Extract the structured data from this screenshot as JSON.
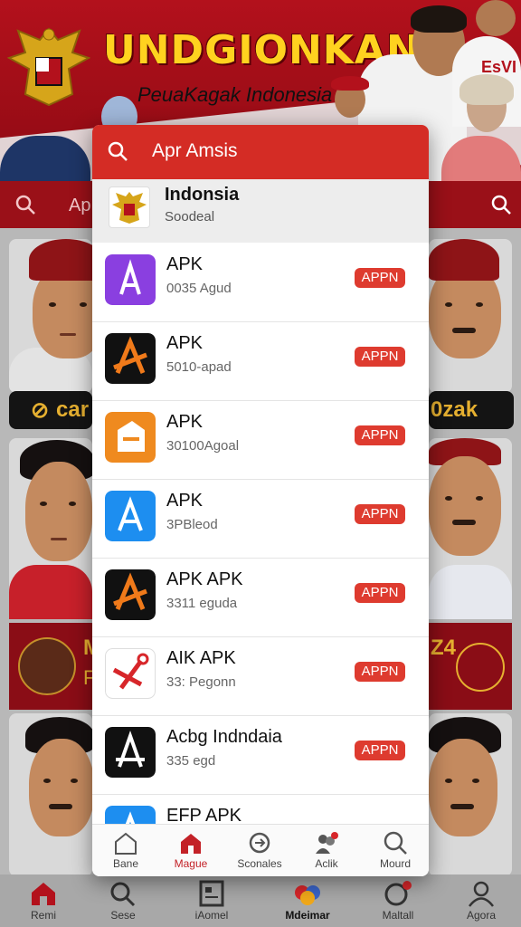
{
  "banner": {
    "title": "UNDGIONKAN",
    "subtitle": "PeuaKagak Indonesia",
    "shirt_text": "EsVI"
  },
  "background_search": {
    "placeholder": "Ap"
  },
  "background_cards": {
    "left_pill": "car",
    "right_pill": "0zak",
    "band_left": "M",
    "band_left_sub": "F",
    "band_right": "Z4"
  },
  "modal": {
    "search_text": "Apr Amsis",
    "featured": {
      "name": "Indonsia",
      "sub": "Soodeal",
      "icon": "garuda-emblem-icon"
    },
    "items": [
      {
        "name": "APK",
        "meta": "0035 Agud",
        "button": "APPN",
        "icon": "purple-a-app-icon",
        "color": "#8a3fe0"
      },
      {
        "name": "APK",
        "meta": "5010-apad",
        "button": "APPN",
        "icon": "black-orange-a-app-icon",
        "color": "#111111"
      },
      {
        "name": "APK",
        "meta": "30100Agoal",
        "button": "APPN",
        "icon": "orange-box-app-icon",
        "color": "#ef8a1f"
      },
      {
        "name": "APK",
        "meta": "3PBleod",
        "button": "APPN",
        "icon": "blue-a-app-icon",
        "color": "#1d8ef0"
      },
      {
        "name": "APK APK",
        "meta": "3311 eguda",
        "button": "APPN",
        "icon": "black-orange-a-app-icon",
        "color": "#111111"
      },
      {
        "name": "AIK APK",
        "meta": "33: Pegonn",
        "button": "APPN",
        "icon": "red-tools-app-icon",
        "color": "#ffffff"
      },
      {
        "name": "Acbg Indndaia",
        "meta": "335 egd",
        "button": "APPN",
        "icon": "black-a-app-icon",
        "color": "#111111"
      },
      {
        "name": "EFP APK",
        "meta": "",
        "button": "",
        "icon": "blue-a-app-icon",
        "color": "#1d8ef0"
      }
    ],
    "nav": [
      {
        "label": "Bane",
        "icon": "home-outline-icon"
      },
      {
        "label": "Mague",
        "icon": "home-filled-icon",
        "active": true
      },
      {
        "label": "Sconales",
        "icon": "refresh-icon"
      },
      {
        "label": "Aclik",
        "icon": "people-icon"
      },
      {
        "label": "Mourd",
        "icon": "search-icon"
      }
    ]
  },
  "bottom_nav": [
    {
      "label": "Remi",
      "icon": "home-icon"
    },
    {
      "label": "Sese",
      "icon": "search-icon"
    },
    {
      "label": "iAomel",
      "icon": "document-icon"
    },
    {
      "label": "Mdeimar",
      "icon": "colors-icon"
    },
    {
      "label": "Maltall",
      "icon": "notification-icon"
    },
    {
      "label": "Agora",
      "icon": "profile-icon"
    }
  ]
}
